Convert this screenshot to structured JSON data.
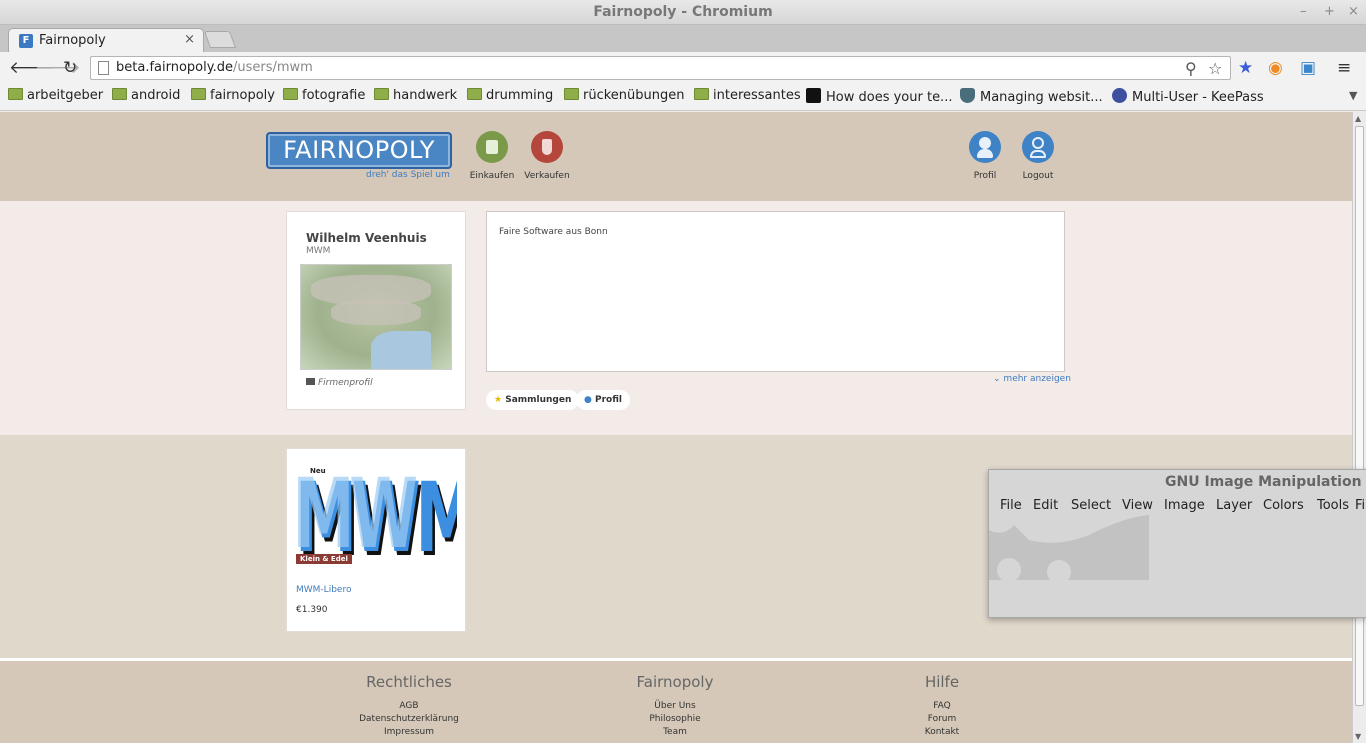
{
  "window": {
    "title": "Fairnopoly - Chromium",
    "controls": [
      "–",
      "+",
      "×"
    ]
  },
  "tab": {
    "favicon_letter": "F",
    "label": "Fairnopoly",
    "close": "×"
  },
  "address": {
    "host": "beta.fairnopoly.de",
    "path": "/users/mwm"
  },
  "bookmarks": [
    {
      "label": "arbeitgeber",
      "icon": "folder-icon"
    },
    {
      "label": "android",
      "icon": "folder-icon"
    },
    {
      "label": "fairnopoly",
      "icon": "folder-icon"
    },
    {
      "label": "fotografie",
      "icon": "folder-icon"
    },
    {
      "label": "handwerk",
      "icon": "folder-icon"
    },
    {
      "label": "drumming",
      "icon": "folder-icon"
    },
    {
      "label": "rückenübungen",
      "icon": "folder-icon"
    },
    {
      "label": "interessantes",
      "icon": "folder-icon"
    },
    {
      "label": "How does your te...",
      "icon": "hackerrank-icon"
    },
    {
      "label": "Managing websit...",
      "icon": "shield-icon"
    },
    {
      "label": "Multi-User - KeePass",
      "icon": "keepass-icon"
    }
  ],
  "site": {
    "logo": "FAIRNOPOLY",
    "tagline": "dreh' das Spiel um",
    "nav": {
      "buy": "Einkaufen",
      "sell": "Verkaufen",
      "profile": "Profil",
      "logout": "Logout"
    }
  },
  "profile": {
    "name": "Wilhelm Veenhuis",
    "subtitle": "MWM",
    "type": "Firmenprofil",
    "about": "Faire Software aus Bonn",
    "more": "mehr anzeigen",
    "pills": {
      "collections": "Sammlungen",
      "profile": "Profil"
    }
  },
  "product": {
    "new_badge": "Neu",
    "tag": "Klein & Edel",
    "title": "MWM-Libero",
    "price": "€1.390"
  },
  "footer": {
    "legal": {
      "heading": "Rechtliches",
      "links": [
        "AGB",
        "Datenschutzerklärung",
        "Impressum"
      ]
    },
    "company": {
      "heading": "Fairnopoly",
      "links": [
        "Über Uns",
        "Philosophie",
        "Team"
      ]
    },
    "help": {
      "heading": "Hilfe",
      "links": [
        "FAQ",
        "Forum",
        "Kontakt"
      ]
    }
  },
  "gimp": {
    "title": "GNU Image Manipulation P",
    "menu": [
      "File",
      "Edit",
      "Select",
      "View",
      "Image",
      "Layer",
      "Colors",
      "Tools",
      "Fil"
    ]
  },
  "colors": {
    "brand_blue": "#4b86c4",
    "header_bg": "#d5c8b8",
    "buy_green": "#7a9a4a",
    "sell_red": "#b5463c"
  }
}
